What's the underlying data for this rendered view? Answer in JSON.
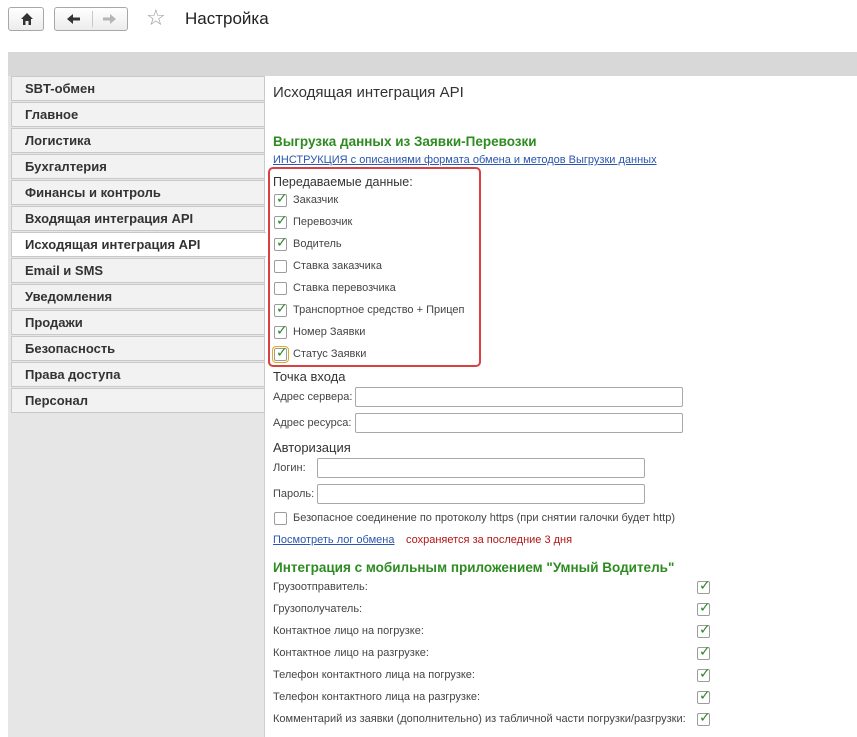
{
  "window": {
    "title": "Настройка"
  },
  "sidebar": {
    "items": [
      "SBT-обмен",
      "Главное",
      "Логистика",
      "Бухгалтерия",
      "Финансы и контроль",
      "Входящая интеграция API",
      "Исходящая интеграция API",
      "Email и SMS",
      "Уведомления",
      "Продажи",
      "Безопасность",
      "Права доступа",
      "Персонал"
    ],
    "active": "Исходящая интеграция API"
  },
  "main": {
    "heading": "Исходящая интеграция API",
    "export_section": {
      "title": "Выгрузка данных из Заявки-Перевозки",
      "instruction_link": "ИНСТРУКЦИЯ с описаниями формата обмена  и методов Выгрузки данных",
      "transmitted_label": "Передаваемые данные:",
      "checkboxes": [
        {
          "label": "Заказчик",
          "checked": true
        },
        {
          "label": "Перевозчик",
          "checked": true
        },
        {
          "label": "Водитель",
          "checked": true
        },
        {
          "label": "Ставка заказчика",
          "checked": false
        },
        {
          "label": "Ставка перевозчика",
          "checked": false
        },
        {
          "label": "Транспортное средство + Прицеп",
          "checked": true
        },
        {
          "label": "Номер Заявки",
          "checked": true
        },
        {
          "label": "Статус Заявки",
          "checked": true
        }
      ]
    },
    "entry_point": {
      "title": "Точка входа",
      "server_label": "Адрес сервера:",
      "server_value": "",
      "resource_label": "Адрес ресурса:",
      "resource_value": ""
    },
    "auth": {
      "title": "Авторизация",
      "login_label": "Логин:",
      "login_value": "",
      "password_label": "Пароль:",
      "password_value": "",
      "https_label": "Безопасное соединение по протоколу https (при снятии галочки будет http)",
      "https_checked": false
    },
    "log": {
      "link": "Посмотреть лог обмена",
      "note": "сохраняется за последние 3 дня"
    },
    "mobile_section": {
      "title": "Интеграция с мобильным приложением \"Умный Водитель\"",
      "items": [
        {
          "label": "Грузоотправитель:",
          "checked": true
        },
        {
          "label": "Грузополучатель:",
          "checked": true
        },
        {
          "label": "Контактное лицо на погрузке:",
          "checked": true
        },
        {
          "label": "Контактное лицо на разгрузке:",
          "checked": true
        },
        {
          "label": "Телефон контактного лица на погрузке:",
          "checked": true
        },
        {
          "label": "Телефон контактного лица на разгрузке:",
          "checked": true
        },
        {
          "label": "Комментарий из заявки (дополнительно) из табличной части погрузки/разгрузки:",
          "checked": true
        }
      ]
    }
  },
  "icons": {
    "home": "home-icon",
    "back": "arrow-left-icon",
    "forward": "arrow-right-icon",
    "favorite": "star-icon",
    "check": "checkmark-icon"
  },
  "colors": {
    "accent_green": "#2e8b22",
    "link_blue": "#2a55b0",
    "highlight_red": "#d94040",
    "note_red": "#b41414"
  }
}
